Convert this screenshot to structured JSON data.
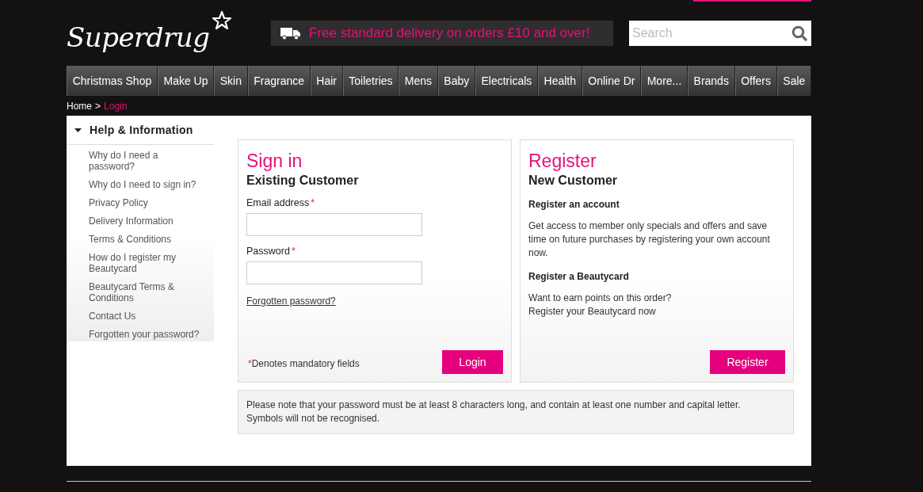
{
  "header": {
    "logo": "Superdrug",
    "promo": "Free standard delivery on orders £10 and over!",
    "search": {
      "placeholder": "Search"
    }
  },
  "nav": [
    {
      "label": "Christmas Shop"
    },
    {
      "label": "Make Up"
    },
    {
      "label": "Skin"
    },
    {
      "label": "Fragrance"
    },
    {
      "label": "Hair"
    },
    {
      "label": "Toiletries"
    },
    {
      "label": "Mens"
    },
    {
      "label": "Baby"
    },
    {
      "label": "Electricals"
    },
    {
      "label": "Health"
    },
    {
      "label": "Online Dr"
    },
    {
      "label": "More..."
    },
    {
      "label": "Brands"
    },
    {
      "label": "Offers"
    },
    {
      "label": "Sale"
    }
  ],
  "breadcrumb": {
    "items": [
      {
        "label": "Home",
        "current": false
      },
      {
        "label": "Login",
        "current": true
      }
    ],
    "separator": ">"
  },
  "sidebar": {
    "title": "Help & Information",
    "expanded": true,
    "items": [
      {
        "label": "Why do I need a password?"
      },
      {
        "label": "Why do I need to sign in?"
      },
      {
        "label": "Privacy Policy"
      },
      {
        "label": "Delivery Information"
      },
      {
        "label": "Terms & Conditions"
      },
      {
        "label": "How do I register my Beautycard"
      },
      {
        "label": "Beautycard Terms & Conditions"
      },
      {
        "label": "Contact Us"
      },
      {
        "label": "Forgotten your password?"
      }
    ]
  },
  "sign_in": {
    "title": "Sign in",
    "subtitle": "Existing Customer",
    "fields": [
      {
        "label": "Email address",
        "required_mark": "*"
      },
      {
        "label": "Password",
        "required_mark": "*"
      }
    ],
    "forgot_link": "Forgotten password?",
    "mandatory_note": {
      "mark": "*",
      "text": "Denotes mandatory fields"
    },
    "button": "Login"
  },
  "register": {
    "title": "Register",
    "subtitle": "New Customer",
    "sections": [
      {
        "heading": "Register an account",
        "lines": [
          "Get access to member only specials and offers and save time on future purchases by registering your own account now."
        ]
      },
      {
        "heading": "Register a Beautycard",
        "lines": [
          "Want to earn points on this order?",
          "Register your Beautycard now"
        ]
      }
    ],
    "button": "Register"
  },
  "password_note": [
    "Please note that your password must be at least 8 characters long, and contain at least one number and capital letter.",
    "Symbols will not be recognised."
  ]
}
